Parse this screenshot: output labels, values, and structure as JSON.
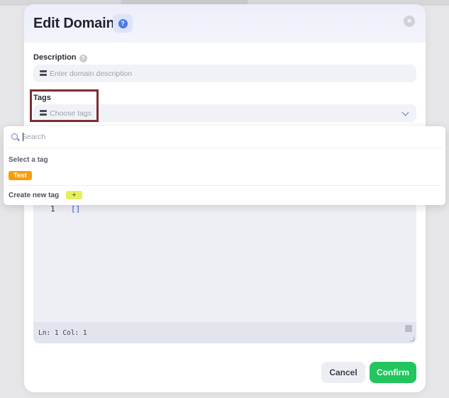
{
  "modal": {
    "title": "Edit Domain",
    "help_icon": "question-icon",
    "close_icon": "close-icon"
  },
  "description": {
    "label": "Description",
    "placeholder": "Enter domain description",
    "icon": "database-icon"
  },
  "tags": {
    "label": "Tags",
    "placeholder": "Choose tags",
    "icon": "database-icon",
    "dropdown": {
      "search_placeholder": "Search",
      "section_label": "Select a tag",
      "options": [
        {
          "label": "Test",
          "color": "#f59e0b"
        }
      ],
      "create_label": "Create new tag",
      "create_button": "+"
    }
  },
  "editor": {
    "line_numbers": [
      "1"
    ],
    "lines": [
      "[]"
    ],
    "status": "Ln: 1  Col: 1"
  },
  "footer": {
    "cancel_label": "Cancel",
    "confirm_label": "Confirm"
  },
  "colors": {
    "accent": "#4b7be5",
    "confirm": "#22c55e",
    "tag": "#f59e0b",
    "highlight": "#7a2f33"
  }
}
